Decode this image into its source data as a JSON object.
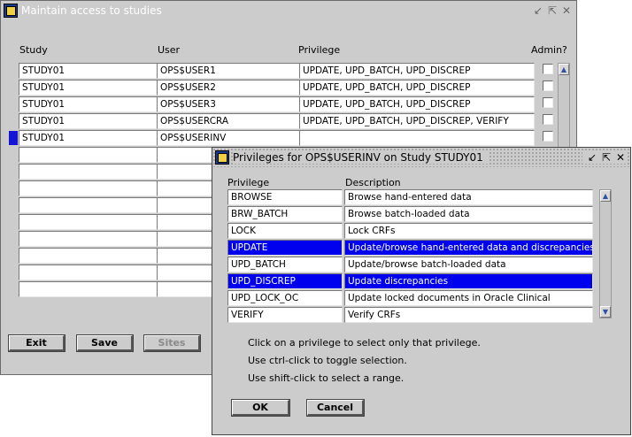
{
  "main_window": {
    "title": "Maintain access to studies",
    "title_buttons": [
      "↙",
      "⇱",
      "✕"
    ],
    "headers": {
      "study": "Study",
      "user": "User",
      "privilege": "Privilege",
      "admin": "Admin?"
    },
    "rows": [
      {
        "study": "STUDY01",
        "user": "OPS$USER1",
        "privilege": "UPDATE, UPD_BATCH, UPD_DISCREP"
      },
      {
        "study": "STUDY01",
        "user": "OPS$USER2",
        "privilege": "UPDATE, UPD_BATCH, UPD_DISCREP"
      },
      {
        "study": "STUDY01",
        "user": "OPS$USER3",
        "privilege": "UPDATE, UPD_BATCH, UPD_DISCREP"
      },
      {
        "study": "STUDY01",
        "user": "OPS$USERCRA",
        "privilege": "UPDATE, UPD_BATCH, UPD_DISCREP, VERIFY"
      },
      {
        "study": "STUDY01",
        "user": "OPS$USERINV",
        "privilege": ""
      },
      {
        "study": "",
        "user": "",
        "privilege": ""
      },
      {
        "study": "",
        "user": "",
        "privilege": ""
      },
      {
        "study": "",
        "user": "",
        "privilege": ""
      },
      {
        "study": "",
        "user": "",
        "privilege": ""
      },
      {
        "study": "",
        "user": "",
        "privilege": ""
      },
      {
        "study": "",
        "user": "",
        "privilege": ""
      },
      {
        "study": "",
        "user": "",
        "privilege": ""
      },
      {
        "study": "",
        "user": "",
        "privilege": ""
      },
      {
        "study": "",
        "user": "",
        "privilege": ""
      }
    ],
    "buttons": {
      "exit": "Exit",
      "save": "Save",
      "sites": "Sites"
    }
  },
  "dialog": {
    "title": "Privileges for OPS$USERINV on Study STUDY01",
    "title_buttons": [
      "↙",
      "⇱",
      "✕"
    ],
    "headers": {
      "privilege": "Privilege",
      "description": "Description"
    },
    "items": [
      {
        "privilege": "BROWSE",
        "description": "Browse hand-entered data",
        "selected": false
      },
      {
        "privilege": "BRW_BATCH",
        "description": "Browse batch-loaded data",
        "selected": false
      },
      {
        "privilege": "LOCK",
        "description": "Lock CRFs",
        "selected": false
      },
      {
        "privilege": "UPDATE",
        "description": "Update/browse hand-entered data and discrepancies",
        "selected": true
      },
      {
        "privilege": "UPD_BATCH",
        "description": "Update/browse batch-loaded data",
        "selected": false
      },
      {
        "privilege": "UPD_DISCREP",
        "description": "Update discrepancies",
        "selected": true
      },
      {
        "privilege": "UPD_LOCK_OC",
        "description": "Update locked documents in Oracle Clinical",
        "selected": false
      },
      {
        "privilege": "VERIFY",
        "description": "Verify CRFs",
        "selected": false
      }
    ],
    "help": [
      "Click on a privilege to select only that privilege.",
      "Use ctrl-click to toggle selection.",
      "Use shift-click to select a range."
    ],
    "buttons": {
      "ok": "OK",
      "cancel": "Cancel"
    }
  },
  "colors": {
    "selection": "#0000ee",
    "record_indicator": "#1515d6",
    "window_bg": "#cccccc"
  }
}
